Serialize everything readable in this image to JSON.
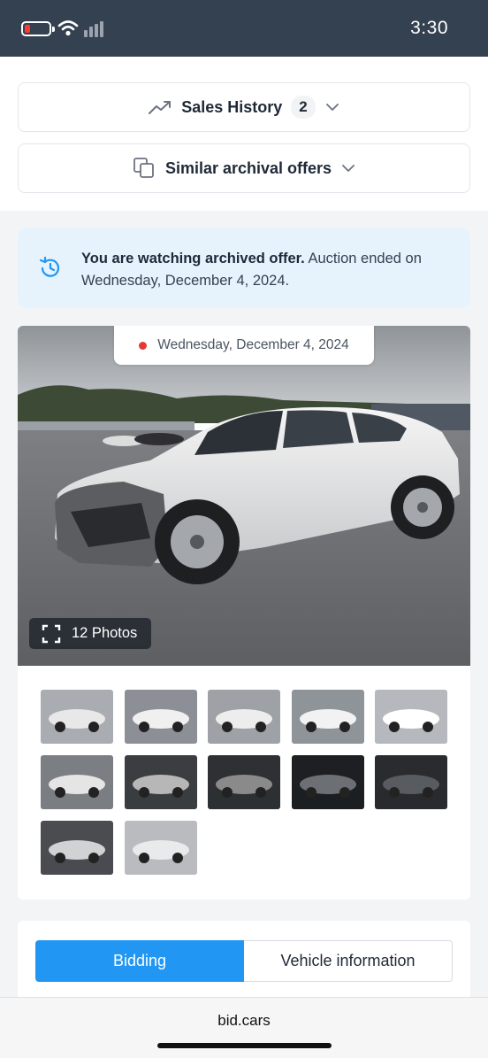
{
  "status_bar": {
    "time": "3:30"
  },
  "sales_history": {
    "label": "Sales History",
    "count": "2",
    "icon": "trending-up-icon"
  },
  "similar_offers": {
    "label": "Similar archival offers",
    "icon": "copy-icon"
  },
  "notice": {
    "bold_text": "You are watching archived offer.",
    "rest_text": " Auction ended on Wednesday, December 4, 2024.",
    "icon": "history-icon",
    "bg_color": "#e6f3fd"
  },
  "gallery": {
    "date": "Wednesday, December 4, 2024",
    "photos_label": "12 Photos",
    "thumbnail_count": 12,
    "dot_color": "#e53935"
  },
  "tabs": {
    "bidding": "Bidding",
    "vehicle_info": "Vehicle information",
    "active_color": "#2196f3"
  },
  "browser": {
    "url": "bid.cars"
  }
}
